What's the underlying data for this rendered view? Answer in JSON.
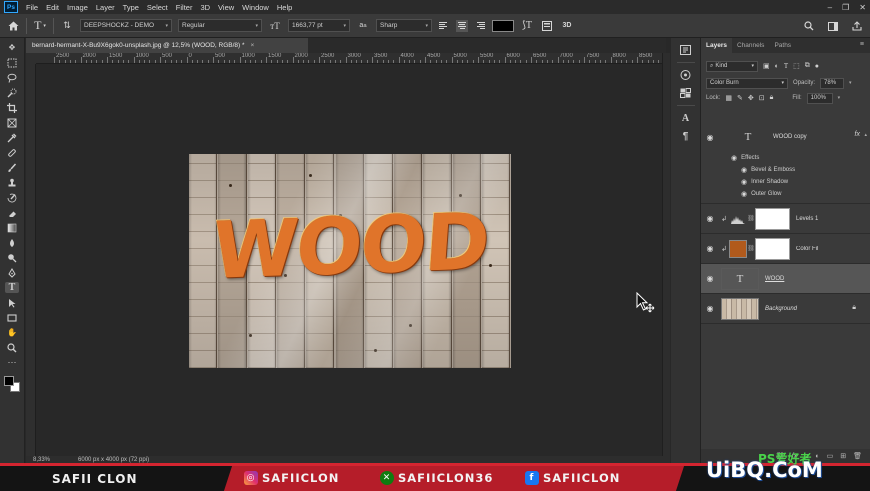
{
  "app": {
    "logo": "Ps"
  },
  "menu": [
    "File",
    "Edit",
    "Image",
    "Layer",
    "Type",
    "Select",
    "Filter",
    "3D",
    "View",
    "Window",
    "Help"
  ],
  "options": {
    "font_family": "DEEPSHOCKZ - DEMO",
    "font_style": "Regular",
    "font_size": "1663,77 pt",
    "anti_alias": "Sharp",
    "color": "#000000",
    "mode_3d": "3D"
  },
  "document": {
    "tab_title": "bernard-hermant-X-Bu9X6gok0-unsplash.jpg @ 12,5% (WOOD, RGB/8) *",
    "close": "×",
    "ruler_marks": [
      "2500",
      "2000",
      "1500",
      "1000",
      "500",
      "0",
      "500",
      "1000",
      "1500",
      "2000",
      "2500",
      "3000",
      "3500",
      "4000",
      "4500",
      "5000",
      "5500",
      "6000",
      "6500",
      "7000",
      "7500",
      "8000",
      "8500",
      "9000"
    ],
    "artwork_text": "WOOD"
  },
  "status": {
    "zoom": "8,33%",
    "doc_size": "6000 px x 4000 px (72 ppi)"
  },
  "layers_panel": {
    "tabs": [
      "Layers",
      "Channels",
      "Paths"
    ],
    "filter_kind": "Kind",
    "blend_mode": "Color Burn",
    "opacity_label": "Opacity:",
    "opacity_value": "78%",
    "lock_label": "Lock:",
    "fill_label": "Fill:",
    "fill_value": "100%",
    "layers": [
      {
        "name": "WOOD copy",
        "type": "text",
        "fx": "fx"
      },
      {
        "name": "Levels 1",
        "type": "adjustment"
      },
      {
        "name": "Color Fill 1",
        "type": "fill"
      },
      {
        "name": "WOOD",
        "type": "text",
        "selected": true
      },
      {
        "name": "Background",
        "type": "image",
        "locked": true
      }
    ],
    "effects_label": "Effects",
    "effects": [
      "Bevel & Emboss",
      "Inner Shadow",
      "Outer Glow"
    ]
  },
  "banner": {
    "name": "SAFII CLON",
    "instagram": "SAFIICLON",
    "xbox": "SAFIICLON36",
    "facebook": "SAFIICLON"
  },
  "watermark": {
    "main": "UiBQ.CoM",
    "sub": "PS爱好者"
  },
  "colors": {
    "accent": "#31a8ff",
    "banner_red": "#d42530",
    "fill_layer": "#b15a1c"
  }
}
